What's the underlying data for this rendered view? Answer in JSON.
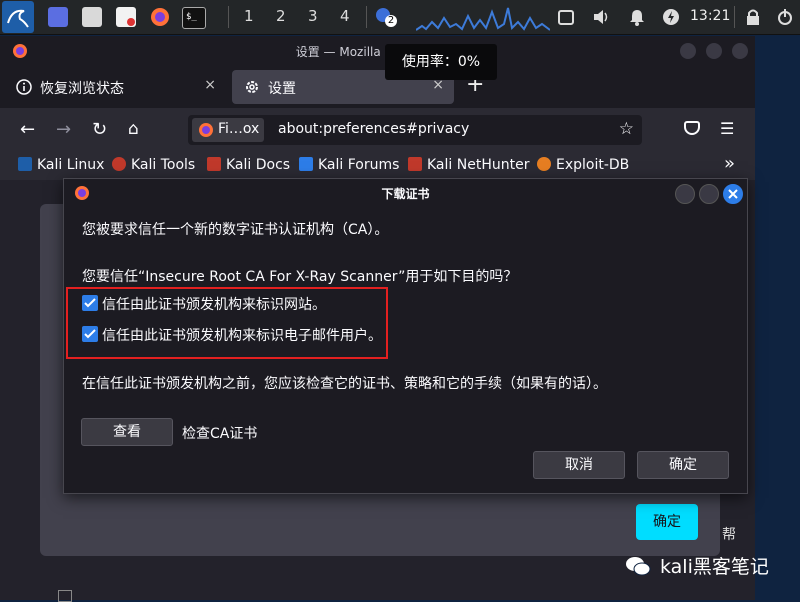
{
  "panel": {
    "workspaces": [
      "1",
      "2",
      "3",
      "4"
    ],
    "clock": "13:21",
    "notify_badge": "2"
  },
  "tooltip": "使用率：0%",
  "window": {
    "title": "设置 — Mozilla Firefox"
  },
  "tabs": [
    {
      "label": "恢复浏览状态",
      "icon": "info-icon",
      "close": "×"
    },
    {
      "label": "设置",
      "icon": "gear-icon",
      "close": "×"
    }
  ],
  "new_tab": "+",
  "navbar": {
    "identity_label": "Fi…ox",
    "url": "about:preferences#privacy"
  },
  "bookmarks": [
    {
      "label": "Kali Linux",
      "color": "#1e5ea8"
    },
    {
      "label": "Kali Tools",
      "color": "#c0392b"
    },
    {
      "label": "Kali Docs",
      "color": "#c0392b"
    },
    {
      "label": "Kali Forums",
      "color": "#2d7de8"
    },
    {
      "label": "Kali NetHunter",
      "color": "#c0392b"
    },
    {
      "label": "Exploit-DB",
      "color": "#e67e22"
    }
  ],
  "overflow": "»",
  "dialog": {
    "title": "下载证书",
    "line1": "您被要求信任一个新的数字证书认证机构（CA）。",
    "line2": "您要信任“Insecure Root CA For X-Ray Scanner”用于如下目的吗？",
    "checkbox_websites": "信任由此证书颁发机构来标识网站。",
    "checkbox_email": "信任由此证书颁发机构来标识电子邮件用户。",
    "websites_checked": true,
    "email_checked": true,
    "line3": "在信任此证书颁发机构之前，您应该检查它的证书、策略和它的手续（如果有的话）。",
    "view_button": "查看",
    "view_label": "检查CA证书",
    "cancel_button": "取消",
    "ok_button": "确定"
  },
  "behind": {
    "ok_button": "确定",
    "partial_text": "帮"
  },
  "watermark": "kali黑客笔记",
  "colors": {
    "accent": "#00ddff",
    "checkbox": "#2d7de8",
    "highlight": "#e32020"
  }
}
